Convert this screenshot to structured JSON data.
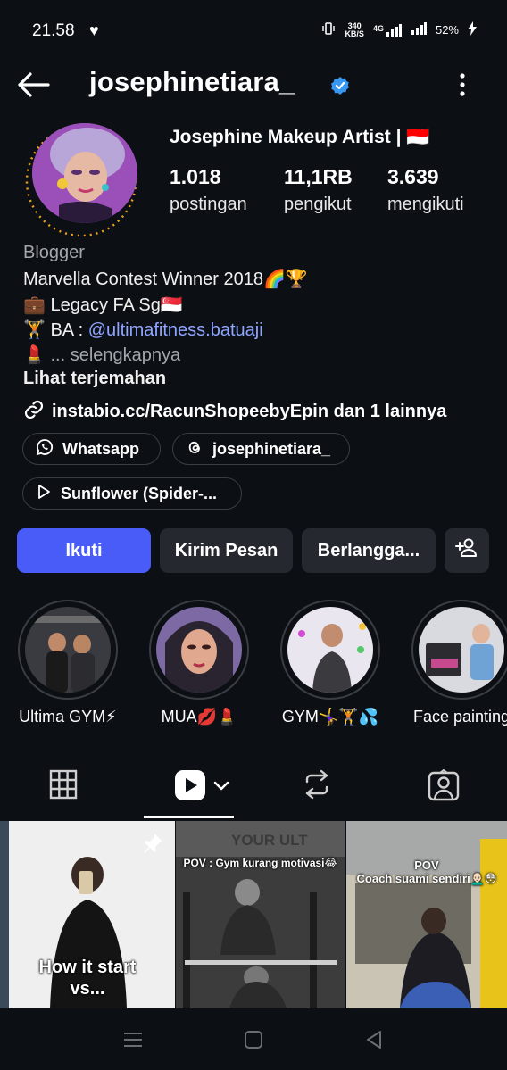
{
  "status_bar": {
    "time": "21.58",
    "network_speed_top": "340",
    "network_speed_unit": "KB/S",
    "network_type": "4G",
    "battery": "52%"
  },
  "header": {
    "username": "josephinetiara_"
  },
  "profile": {
    "full_name": "Josephine Makeup Artist | 🇮🇩",
    "stats": [
      {
        "value": "1.018",
        "label": "postingan"
      },
      {
        "value": "11,1RB",
        "label": "pengikut"
      },
      {
        "value": "3.639",
        "label": "mengikuti"
      }
    ],
    "category": "Blogger",
    "bio_lines": [
      "Marvella Contest Winner 2018🌈🏆",
      "💼 Legacy FA Sg🇸🇬"
    ],
    "ba_prefix": "🏋️ BA : ",
    "ba_handle": "@ultimafitness.batuaji",
    "more_prefix": "💄 ",
    "more_text": "... selengkapnya",
    "translate": "Lihat terjemahan",
    "link_text": "instabio.cc/RacunShopeebyEpin dan 1 lainnya"
  },
  "pills": {
    "whatsapp": "Whatsapp",
    "threads": "josephinetiara_",
    "music": "Sunflower (Spider-..."
  },
  "actions": {
    "follow": "Ikuti",
    "message": "Kirim Pesan",
    "subscribe": "Berlangga..."
  },
  "highlights": [
    {
      "label": "Ultima GYM⚡"
    },
    {
      "label": "MUA💋💄"
    },
    {
      "label": "GYM🤸‍♀️🏋️💦"
    },
    {
      "label": "Face painting"
    }
  ],
  "tiles": [
    {
      "caption": "How it start\nvs..."
    },
    {
      "caption": "POV : Gym kurang motivasi😂",
      "sign": "YOUR ULT"
    },
    {
      "caption": "POV\nCoach suami sendiri👨🏻‍🦲😳"
    }
  ],
  "colors": {
    "background": "#0c0f14",
    "primary_button": "#4a5cf8",
    "secondary_button": "#262830",
    "link": "#8fa6ff",
    "verified": "#3897f0"
  }
}
